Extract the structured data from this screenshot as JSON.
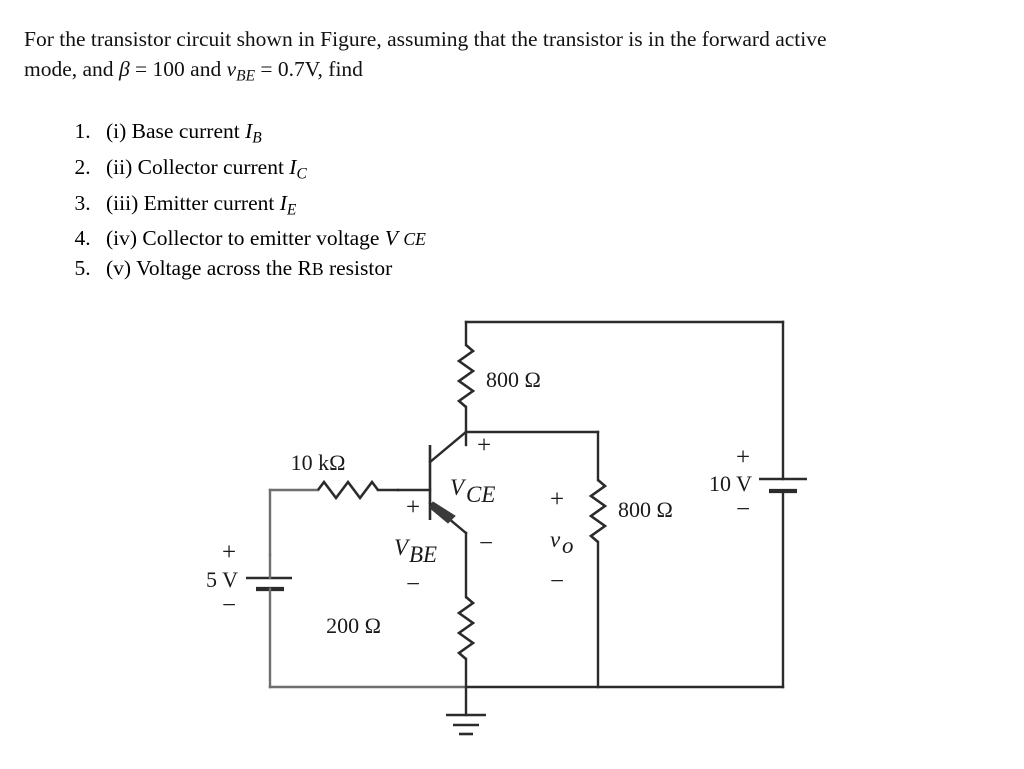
{
  "problem": {
    "line1_pre": "For the transistor circuit shown in Figure, assuming that the transistor is in the forward active",
    "line2_a": "mode, and ",
    "beta_symbol": "β",
    "line2_b": " = 100 and ",
    "vbe_symbol": "v",
    "vbe_sub": "BE",
    "line2_c": " = 0.7V, find"
  },
  "questions": [
    {
      "roman": "(i)",
      "text": "Base current",
      "symbol": "I",
      "sub": "B"
    },
    {
      "roman": "(ii)",
      "text": "Collector current",
      "symbol": "I",
      "sub": "C"
    },
    {
      "roman": "(iii)",
      "text": "Emitter current",
      "symbol": "I",
      "sub": "E"
    },
    {
      "roman": "(iv)",
      "text": "Collector to emitter voltage",
      "symbol": "V",
      "sub": "CE"
    },
    {
      "roman": "(v)",
      "text": "Voltage across the",
      "symbol": "R",
      "sub": "B",
      "suffix": "resistor"
    }
  ],
  "circuit": {
    "title": "transistor-circuit-figure",
    "components": {
      "rb_label": "10 kΩ",
      "rc_label": "800 Ω",
      "rload_label": "800 Ω",
      "re_label": "200 Ω",
      "vsource_left": "5 V",
      "vsource_right": "10 V"
    },
    "node_labels": {
      "vce": "V",
      "vce_sub": "CE",
      "vbe": "V",
      "vbe_sub": "BE",
      "vo": "v",
      "vo_sub": "o"
    },
    "polarity": {
      "plus": "+",
      "minus": "−"
    }
  },
  "colors": {
    "ink": "#1a1a1a",
    "wire": "#2b2b2b",
    "wire_light": "#6e6e6e",
    "background": "#ffffff"
  }
}
